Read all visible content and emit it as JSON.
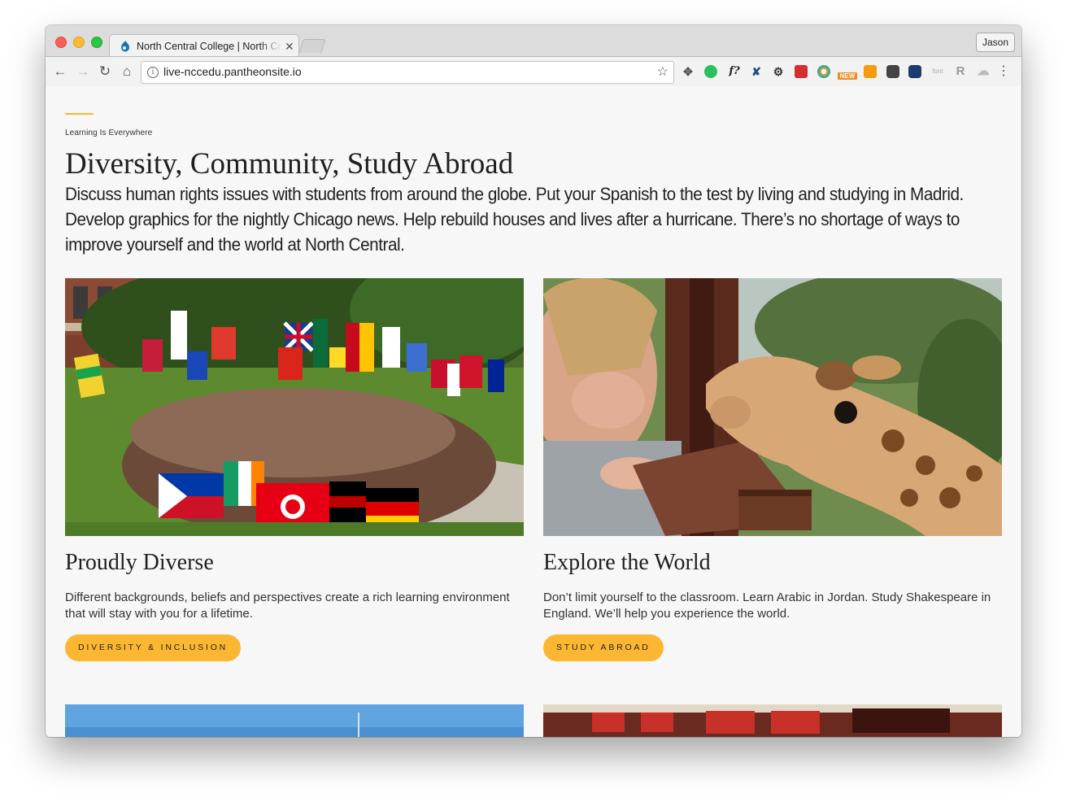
{
  "browser": {
    "tab_title": "North Central College | North Central College",
    "profile_name": "Jason",
    "url": "live-nccedu.pantheonsite.io",
    "extensions": [
      "move-icon",
      "evernote-icon",
      "font-question-icon",
      "hook-icon",
      "gear-icon",
      "lastpass-icon",
      "color-picker-icon",
      "new-badge-icon",
      "analytics-icon",
      "camera-icon",
      "screenshot-icon",
      "font-icon",
      "r-icon",
      "cloud-icon"
    ],
    "extension_labels": {
      "font_question": "f?",
      "new_badge": "NEW",
      "font": "font"
    }
  },
  "page": {
    "eyebrow": "Learning Is Everywhere",
    "heading": "Diversity, Community, Study Abroad",
    "intro": "Discuss human rights issues with students from around the globe. Put your Spanish to the test by living and studying in Madrid. Develop graphics for the nightly Chicago news. Help rebuild houses and lives after a hurricane. There’s no shortage of ways to improve yourself and the world at North Central.",
    "cards": [
      {
        "title": "Proudly Diverse",
        "description": "Different backgrounds, beliefs and perspectives create a rich learning environment that will stay with you for a lifetime.",
        "button": "DIVERSITY & INCLUSION"
      },
      {
        "title": "Explore the World",
        "description": "Don’t limit yourself to the classroom. Learn Arabic in Jordan. Study Shakespeare in England. We’ll help you experience the world.",
        "button": "STUDY ABROAD"
      }
    ]
  },
  "colors": {
    "accent": "#fbb731",
    "page_background": "#f7f7f7"
  }
}
